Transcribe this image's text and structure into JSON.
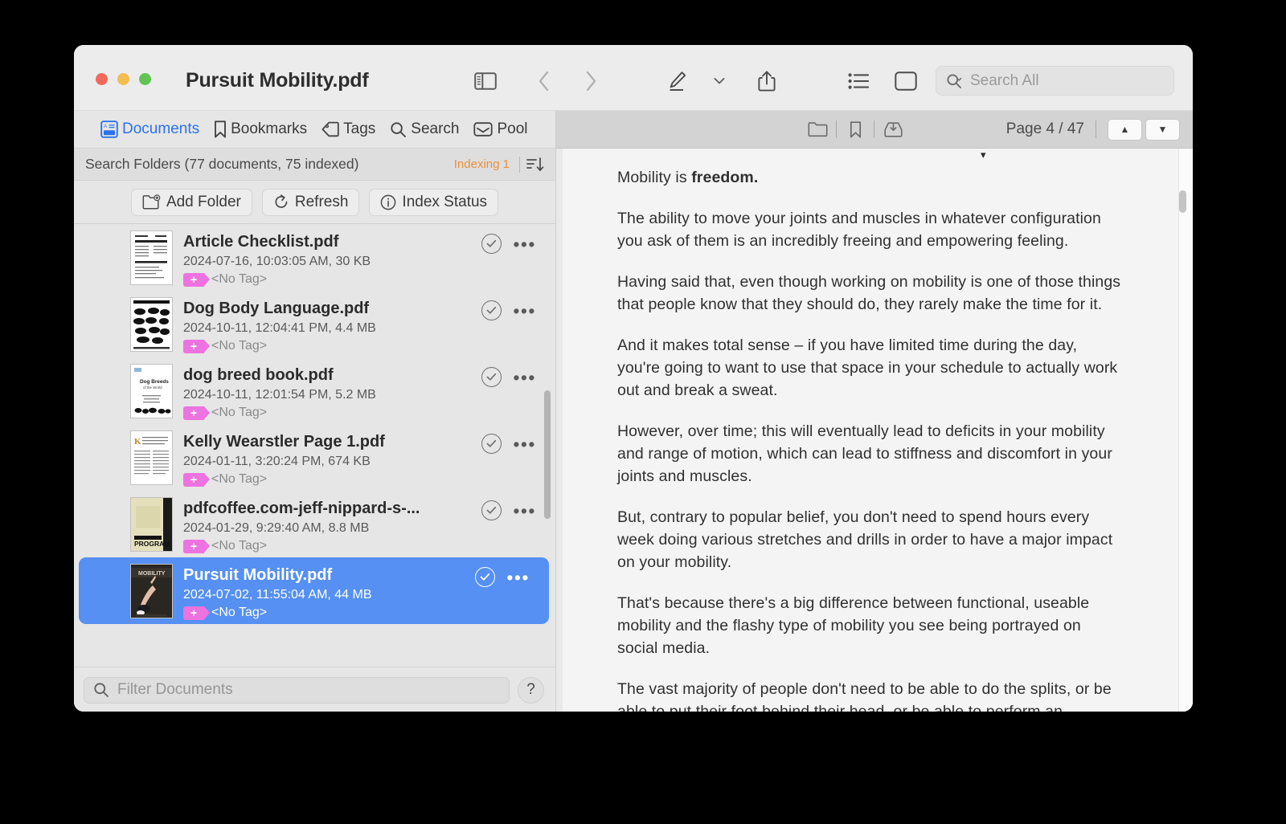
{
  "window": {
    "title": "Pursuit Mobility.pdf",
    "traffic_lights": [
      "close",
      "minimize",
      "zoom"
    ],
    "accent_blue": "#2b72ec",
    "selection_blue": "#5590f2",
    "tag_pink": "#ee72e0",
    "indexing_orange": "#e8913c"
  },
  "toolbar": {
    "sidebar_toggle": "sidebar-toggle-icon",
    "back": "chevron-left-icon",
    "forward": "chevron-right-icon",
    "markup": "pen-markup-icon",
    "markup_menu": "chevron-down-icon",
    "share": "share-icon",
    "list_view": "list-view-icon",
    "inspector": "panel-icon",
    "search_placeholder": "Search All",
    "search_value": ""
  },
  "sidebar": {
    "tabs": [
      {
        "label": "Documents",
        "icon": "documents-icon",
        "active": true
      },
      {
        "label": "Bookmarks",
        "icon": "bookmark-icon",
        "active": false
      },
      {
        "label": "Tags",
        "icon": "tag-icon",
        "active": false
      },
      {
        "label": "Search",
        "icon": "magnifier-icon",
        "active": false
      },
      {
        "label": "Pool",
        "icon": "pool-inbox-icon",
        "active": false
      }
    ],
    "search_folders": {
      "title": "Search Folders (77 documents, 75 indexed)",
      "documents_count": 77,
      "indexed_count": 75,
      "indexing_status": "Indexing 1",
      "sort_icon": "sort-descending-icon"
    },
    "actions": [
      {
        "label": "Add Folder",
        "icon": "folder-add-icon"
      },
      {
        "label": "Refresh",
        "icon": "refresh-icon"
      },
      {
        "label": "Index Status",
        "icon": "info-circle-icon"
      }
    ],
    "documents": [
      {
        "name": "Article Checklist.pdf",
        "meta": "2024-07-16, 10:03:05 AM, 30 KB",
        "tag": "<No Tag>",
        "selected": false,
        "thumb": "checklist"
      },
      {
        "name": "Dog Body Language.pdf",
        "meta": "2024-10-11, 12:04:41 PM, 4.4 MB",
        "tag": "<No Tag>",
        "selected": false,
        "thumb": "dogs"
      },
      {
        "name": "dog breed book.pdf",
        "meta": "2024-10-11, 12:01:54 PM, 5.2 MB",
        "tag": "<No Tag>",
        "selected": false,
        "thumb": "breeds"
      },
      {
        "name": "Kelly Wearstler Page 1.pdf",
        "meta": "2024-01-11, 3:20:24 PM, 674 KB",
        "tag": "<No Tag>",
        "selected": false,
        "thumb": "article"
      },
      {
        "name": "pdfcoffee.com-jeff-nippard-s-...",
        "meta": "2024-01-29, 9:29:40 AM, 8.8 MB",
        "tag": "<No Tag>",
        "selected": false,
        "thumb": "program"
      },
      {
        "name": "Pursuit Mobility.pdf",
        "meta": "2024-07-02, 11:55:04 AM, 44 MB",
        "tag": "<No Tag>",
        "selected": true,
        "thumb": "mobility"
      }
    ],
    "filter": {
      "placeholder": "Filter Documents",
      "value": "",
      "help_label": "?"
    }
  },
  "viewer": {
    "toolbar": {
      "folder_icon": "folder-icon",
      "bookmark_icon": "bookmark-icon",
      "download_icon": "inbox-download-icon",
      "page_label": "Page 4 / 47",
      "current_page": 4,
      "total_pages": 47,
      "prev_label": "▲",
      "next_label": "▼"
    },
    "page_content": {
      "paragraphs": [
        "Mobility is freedom.",
        "The ability to move your joints and muscles in whatever configuration you ask of them is an incredibly freeing and empowering feeling.",
        "Having said that, even though working on mobility is one of those things that people know that they should do, they rarely make the time for it.",
        "And it makes total sense – if you have limited time during the day, you're going to want to use that space in your schedule to actually work out and break a sweat.",
        "However, over time; this will eventually lead to deficits in your mobility and range of motion, which can lead to stiffness and discomfort in your joints and muscles.",
        "But, contrary to popular belief, you don't need to spend hours every week doing various stretches and drills in order to have a major impact on your mobility.",
        "That's because there's a big difference between functional, useable mobility and the flashy type of mobility you see being portrayed on social media.",
        "The vast majority of people don't need to be able to do the splits, or be able to put their foot behind their head, or be able to perform an extreme backbend – those are incredibly impressive skills, but have very little actual carryover to everyday life, and would take years of dedicated practice to achieve."
      ]
    }
  }
}
